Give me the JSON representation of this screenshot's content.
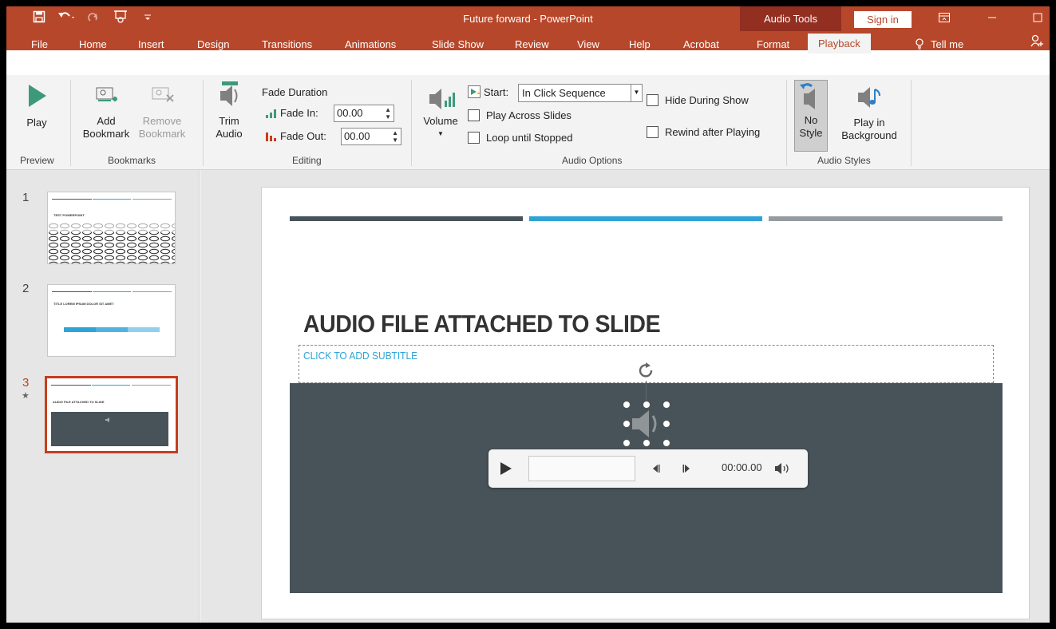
{
  "title_bar": {
    "window_title": "Future forward  -  PowerPoint",
    "context_tab_group": "Audio Tools",
    "sign_in": "Sign in"
  },
  "quick_access": [
    "save-icon",
    "undo-icon",
    "redo-icon",
    "present-icon",
    "customize-icon"
  ],
  "tabs": [
    "File",
    "Home",
    "Insert",
    "Design",
    "Transitions",
    "Animations",
    "Slide Show",
    "Review",
    "View",
    "Help",
    "Acrobat",
    "Format",
    "Playback"
  ],
  "active_tab": "Playback",
  "tell_me": "Tell me",
  "ribbon": {
    "preview": {
      "play": "Play",
      "group": "Preview"
    },
    "bookmarks": {
      "add_line1": "Add",
      "add_line2": "Bookmark",
      "remove_line1": "Remove",
      "remove_line2": "Bookmark",
      "group": "Bookmarks"
    },
    "editing": {
      "trim_line1": "Trim",
      "trim_line2": "Audio",
      "fade_duration": "Fade Duration",
      "fade_in_label": "Fade In:",
      "fade_in_value": "00.00",
      "fade_out_label": "Fade Out:",
      "fade_out_value": "00.00",
      "group": "Editing"
    },
    "audio_options": {
      "volume": "Volume",
      "start_label": "Start:",
      "start_value": "In Click Sequence",
      "play_across": "Play Across Slides",
      "loop": "Loop until Stopped",
      "hide": "Hide During Show",
      "rewind": "Rewind after Playing",
      "group": "Audio Options"
    },
    "audio_styles": {
      "no_style_line1": "No",
      "no_style_line2": "Style",
      "bg_line1": "Play in",
      "bg_line2": "Background",
      "group": "Audio Styles"
    }
  },
  "thumbnails": [
    {
      "num": "1",
      "title": "TEST POWERPOINT"
    },
    {
      "num": "2",
      "title": "TITLE LOREM IPSUM DOLOR SIT AMET"
    },
    {
      "num": "3",
      "title": "AUDIO FILE ATTACHED TO SLIDE",
      "marker": "★"
    }
  ],
  "slide": {
    "title": "AUDIO FILE ATTACHED TO SLIDE",
    "subtitle": "CLICK TO ADD SUBTITLE",
    "player_time": "00:00.00"
  },
  "colors": {
    "accent": "#b7472a",
    "bar_dark": "#475359",
    "bar_blue": "#2ea3d5",
    "bar_gray": "#959ca1"
  }
}
